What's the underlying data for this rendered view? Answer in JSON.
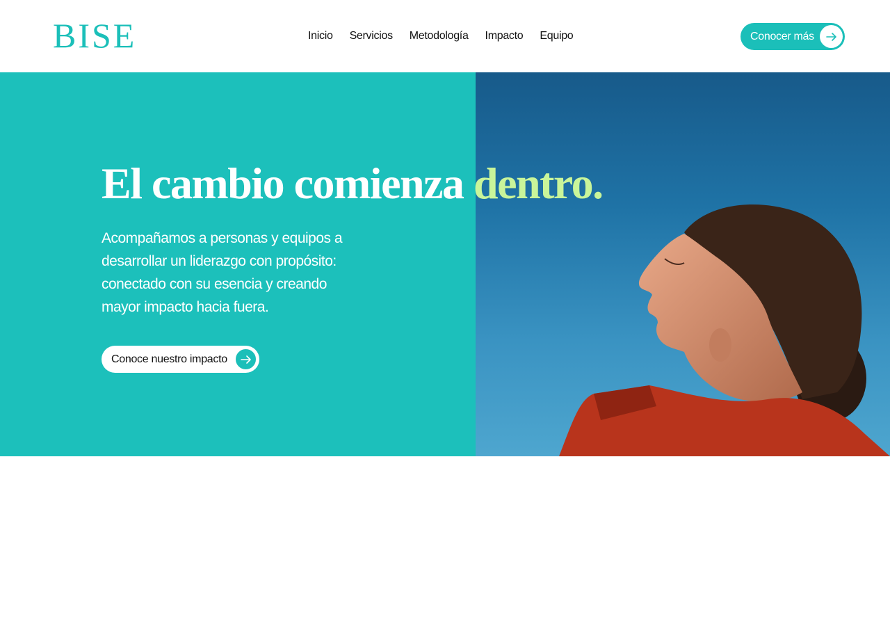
{
  "brand": {
    "logo_text": "BISE"
  },
  "nav": {
    "items": [
      {
        "label": "Inicio"
      },
      {
        "label": "Servicios"
      },
      {
        "label": "Metodología"
      },
      {
        "label": "Impacto"
      },
      {
        "label": "Equipo"
      }
    ]
  },
  "header": {
    "cta_label": "Conocer más",
    "cta_icon": "arrow-right-icon"
  },
  "hero": {
    "headline_main": "El cambio comienza",
    "headline_accent": "dentro.",
    "lead": "Acompañamos a personas y equipos a desarrollar un liderazgo con propósito: conectado con su esencia y creando mayor impacto hacia fuera.",
    "cta_label": "Conoce nuestro impacto",
    "cta_icon": "arrow-right-icon",
    "image_description": "woman-face-sky-photo"
  },
  "colors": {
    "brand_teal": "#1bbfb9",
    "accent_lime": "#c9f59a",
    "sky_blue": "#1f73a6",
    "jacket_red": "#b8341c"
  }
}
